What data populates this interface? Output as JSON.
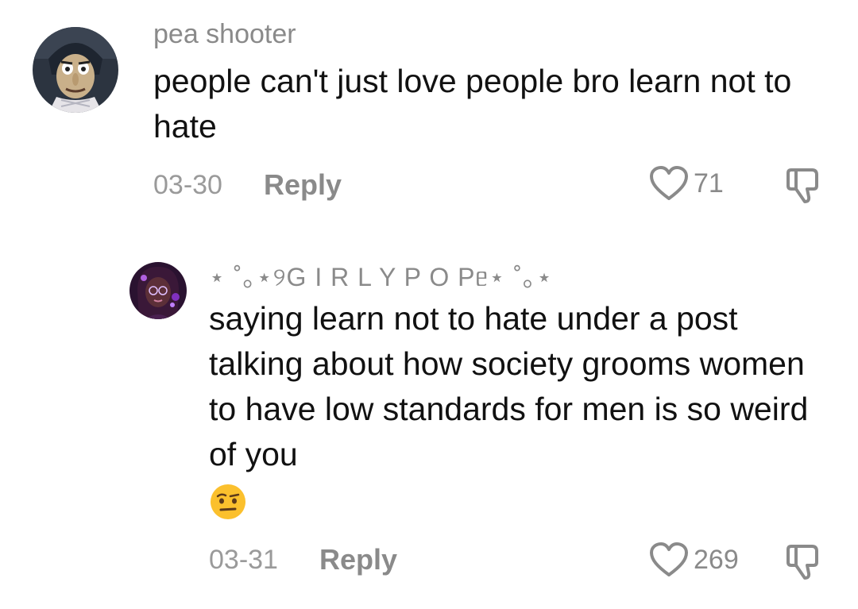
{
  "comments": [
    {
      "username": "pea shooter",
      "text": "people can't just love people bro learn not to hate",
      "date": "03-30",
      "reply_label": "Reply",
      "likes": "71",
      "avatar_icon": "anime-character-avatar",
      "like_icon": "heart-outline-icon",
      "dislike_icon": "thumbs-down-icon"
    },
    {
      "username": "⋆˚｡⋆୨GIRLYPOPE⋆˚｡⋆",
      "username_display": "⋆ ˚｡⋆୨G I R L Y P O Pᥱ⋆ ˚｡⋆",
      "text": "saying learn not to hate under a post talking about how society grooms women to have low standards for men is so weird of you",
      "emoji": "🤨",
      "date": "03-31",
      "reply_label": "Reply",
      "likes": "269",
      "avatar_icon": "purple-character-avatar",
      "like_icon": "heart-outline-icon",
      "dislike_icon": "thumbs-down-icon"
    }
  ],
  "colors": {
    "meta_gray": "#8a8a8a",
    "text": "#111111",
    "background": "#ffffff"
  }
}
